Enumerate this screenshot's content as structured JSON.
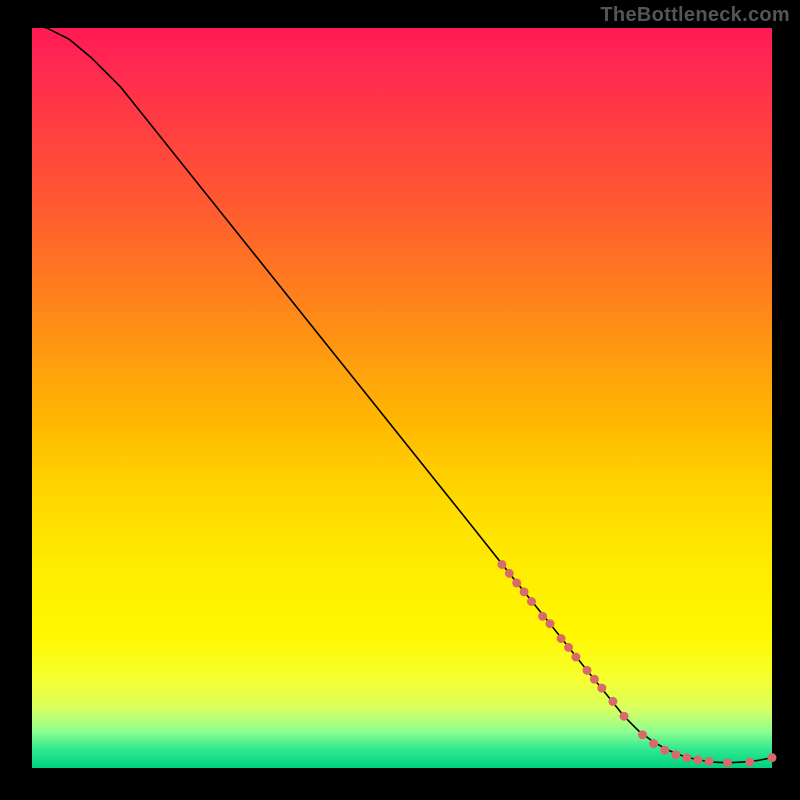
{
  "watermark": "TheBottleneck.com",
  "chart_data": {
    "type": "line",
    "title": "",
    "xlabel": "",
    "ylabel": "",
    "xlim": [
      0,
      100
    ],
    "ylim": [
      0,
      100
    ],
    "curve": {
      "x": [
        0,
        2,
        5,
        8,
        12,
        20,
        30,
        40,
        50,
        60,
        65,
        70,
        75,
        78,
        80,
        82,
        84,
        86,
        88,
        90,
        92,
        94,
        96,
        98,
        100
      ],
      "y": [
        100.5,
        100,
        98.5,
        96,
        92,
        82,
        69.5,
        57,
        44.5,
        32,
        25.7,
        19.5,
        13.2,
        9.5,
        7,
        5,
        3.5,
        2.4,
        1.6,
        1.1,
        0.8,
        0.7,
        0.8,
        1.0,
        1.4
      ]
    },
    "points": {
      "x": [
        63.5,
        64.5,
        65.5,
        66.5,
        67.5,
        69,
        70,
        71.5,
        72.5,
        73.5,
        75,
        76,
        77,
        78.5,
        80,
        82.5,
        84,
        85.5,
        87,
        88.5,
        90,
        91.5,
        94,
        97,
        100
      ],
      "y": [
        27.5,
        26.3,
        25,
        23.8,
        22.5,
        20.5,
        19.5,
        17.5,
        16.3,
        15,
        13.2,
        12,
        10.8,
        9,
        7,
        4.5,
        3.3,
        2.4,
        1.8,
        1.4,
        1.1,
        0.9,
        0.7,
        0.8,
        1.4
      ]
    }
  }
}
